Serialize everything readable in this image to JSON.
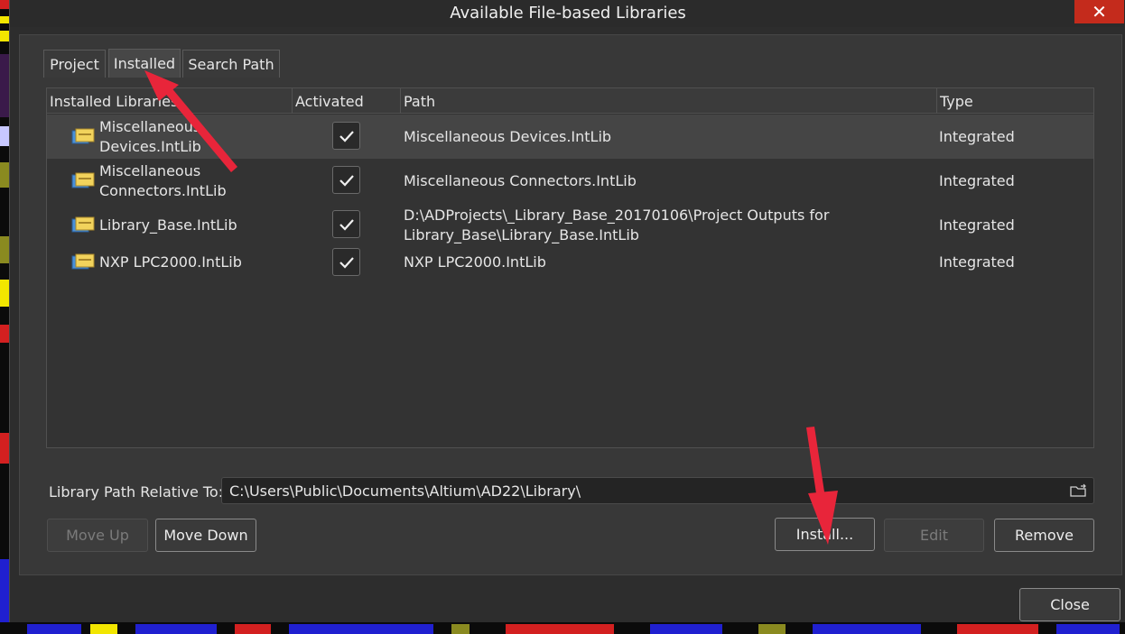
{
  "dialog": {
    "title": "Available File-based Libraries",
    "close_glyph": "✕"
  },
  "tabs": [
    {
      "label": "Project",
      "active": false
    },
    {
      "label": "Installed",
      "active": true
    },
    {
      "label": "Search Path",
      "active": false
    }
  ],
  "table": {
    "columns": [
      "Installed Libraries",
      "Activated",
      "Path",
      "Type"
    ],
    "rows": [
      {
        "name_line1": "Miscellaneous",
        "name_line2": "Devices.IntLib",
        "activated": true,
        "path_line1": "Miscellaneous Devices.IntLib",
        "path_line2": "",
        "type": "Integrated",
        "selected": true
      },
      {
        "name_line1": "Miscellaneous",
        "name_line2": "Connectors.IntLib",
        "activated": true,
        "path_line1": "Miscellaneous Connectors.IntLib",
        "path_line2": "",
        "type": "Integrated",
        "selected": false
      },
      {
        "name_line1": "Library_Base.IntLib",
        "name_line2": "",
        "activated": true,
        "path_line1": "D:\\ADProjects\\_Library_Base_20170106\\Project Outputs for",
        "path_line2": "Library_Base\\Library_Base.IntLib",
        "type": "Integrated",
        "selected": false
      },
      {
        "name_line1": "NXP LPC2000.IntLib",
        "name_line2": "",
        "activated": true,
        "path_line1": "NXP LPC2000.IntLib",
        "path_line2": "",
        "type": "Integrated",
        "selected": false
      }
    ]
  },
  "library_path": {
    "label": "Library Path Relative To:",
    "value": "C:\\Users\\Public\\Documents\\Altium\\AD22\\Library\\"
  },
  "buttons": {
    "move_up": "Move Up",
    "move_down": "Move Down",
    "install": "Install...",
    "edit": "Edit",
    "remove": "Remove",
    "close": "Close"
  },
  "icons": {
    "library": "library-folder-icon",
    "check": "check-icon",
    "browse": "folder-browse-icon"
  },
  "colors": {
    "annotation_arrow": "#e8253a",
    "close_button": "#c42b1c"
  }
}
